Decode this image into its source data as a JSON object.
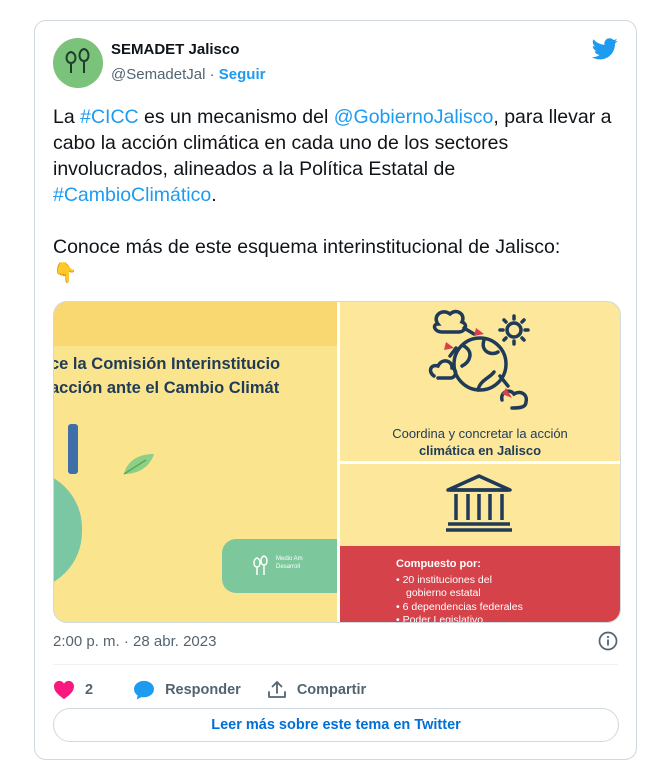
{
  "author": {
    "name": "SEMADET Jalisco",
    "handle": "@SemadetJal",
    "separator": "·",
    "follow_label": "Seguir"
  },
  "tweet": {
    "p1_before": "La ",
    "p1_tag1": "#CICC",
    "p1_mid1": " es un mecanismo del ",
    "p1_tag2": "@GobiernoJalisco",
    "p1_mid2": ", para llevar a cabo la acción climática en cada uno de los sectores involucrados, alineados a la Política Estatal de ",
    "p1_tag3": "#CambioClimático",
    "p1_end": ".",
    "p2": "Conoce más de este esquema interinstitucional de Jalisco:",
    "p2_emoji": "👇"
  },
  "media": {
    "left_line1": "ce la Comisión Interinstitucio",
    "left_line2": "acción ante el Cambio Climát",
    "logo_text1": "Medio Am",
    "logo_text2": "Desarroll",
    "right_top_line1": "Coordina y concretar la acción",
    "right_top_line2": "climática en Jalisco",
    "red_header": "Compuesto por:",
    "red_item1a": "• 20 instituciones del",
    "red_item1b": "gobierno estatal",
    "red_item2": "• 6 dependencias federales",
    "red_item3": "• Poder Legislativo"
  },
  "meta": {
    "timestamp": "2:00 p. m. · 28 abr. 2023"
  },
  "actions": {
    "like_count": "2",
    "reply_label": "Responder",
    "share_label": "Compartir"
  },
  "footer": {
    "read_more": "Leer más sobre este tema en Twitter"
  },
  "colors": {
    "link": "#1d9bf0",
    "like": "#f91880",
    "accent_green": "#7bc27a",
    "media_yellow": "#fde79b",
    "media_red": "#d5424a"
  },
  "icons": {
    "bird": "twitter-bird-icon",
    "info": "info-icon",
    "heart": "heart-icon",
    "reply": "reply-bubble-icon",
    "share": "share-icon"
  }
}
